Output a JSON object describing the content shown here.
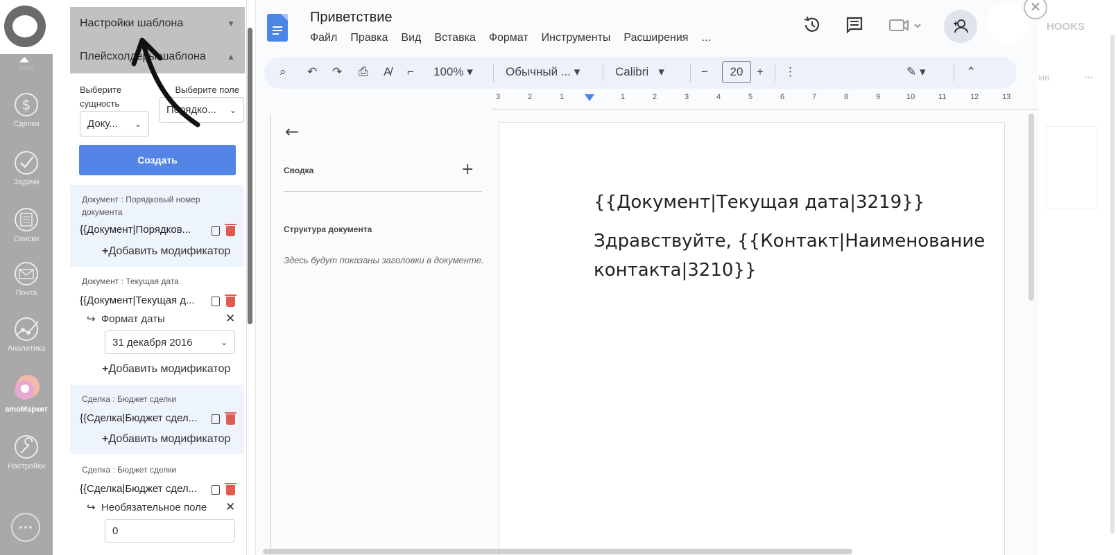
{
  "crm_sidebar": {
    "top_label": "стол",
    "items": [
      {
        "label": "Сделки",
        "icon": "dollar-icon"
      },
      {
        "label": "Задачи",
        "icon": "check-icon"
      },
      {
        "label": "Списки",
        "icon": "list-icon"
      },
      {
        "label": "Почта",
        "icon": "mail-icon"
      },
      {
        "label": "Аналитика",
        "icon": "analytics-icon"
      },
      {
        "label": "amoМаркет",
        "icon": "market-icon"
      },
      {
        "label": "Настройки",
        "icon": "wrench-icon"
      }
    ],
    "chat_icon": "chat-icon"
  },
  "panel": {
    "settings_title": "Настройки шаблона",
    "placeholders_title": "Плейсхолдеры шаблона",
    "entity_label": "Выберите сущность",
    "entity_value": "Доку...",
    "field_label": "Выберите поле",
    "field_value": "Порядко...",
    "create_label": "Создать",
    "add_modifier": "Добавить модификатор",
    "cards": [
      {
        "title": "Документ : Порядковый номер документа",
        "placeholder": "{{Документ|Порядков..."
      },
      {
        "title": "Документ : Текущая дата",
        "placeholder": "{{Документ|Текущая д...",
        "modifier_label": "Формат даты",
        "modifier_value": "31 декабря 2016"
      },
      {
        "title": "Сделка : Бюджет сделки",
        "placeholder": "{{Сделка|Бюджет сдел..."
      },
      {
        "title": "Сделка : Бюджет сделки",
        "placeholder": "{{Сделка|Бюджет сдел...",
        "modifier_label": "Необязательное поле",
        "modifier_value": "0"
      }
    ]
  },
  "docs": {
    "title": "Приветствие",
    "menu": [
      "Файл",
      "Правка",
      "Вид",
      "Вставка",
      "Формат",
      "Инструменты",
      "Расширения",
      "..."
    ],
    "toolbar": {
      "zoom": "100%",
      "style": "Обычный ...",
      "font": "Calibri",
      "font_size": "20"
    },
    "ruler_ticks": [
      "3",
      "2",
      "1",
      "1",
      "2",
      "3",
      "4",
      "5",
      "6",
      "7",
      "8",
      "9",
      "10",
      "11",
      "12",
      "13"
    ],
    "outline": {
      "summary": "Сводка",
      "structure": "Структура документа",
      "hint": "Здесь будут показаны заголовки в документе."
    },
    "body_lines": [
      "{{Документ|Текущая дата|3219}}",
      "Здравствуйте, {{Контакт|Наименование контакта|3210}}"
    ]
  },
  "background": {
    "hooks_label": "HOOKS",
    "partial_label": "ми",
    "more_label": "..."
  }
}
